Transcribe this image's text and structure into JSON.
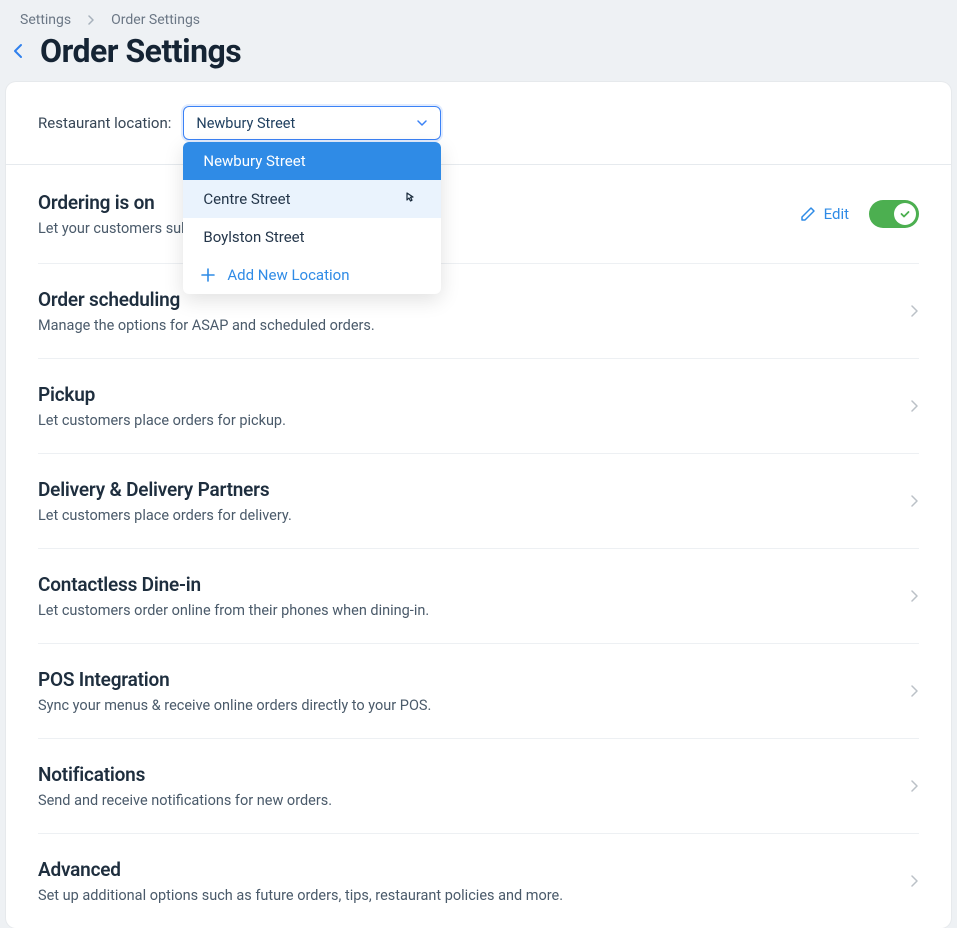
{
  "breadcrumb": {
    "root": "Settings",
    "current": "Order Settings"
  },
  "page": {
    "title": "Order Settings"
  },
  "location": {
    "label": "Restaurant location:",
    "selected": "Newbury Street",
    "options": {
      "opt0": "Newbury Street",
      "opt1": "Centre Street",
      "opt2": "Boylston Street"
    },
    "add_label": "Add New Location"
  },
  "edit": {
    "label": "Edit"
  },
  "sections": {
    "ordering": {
      "title": "Ordering is on",
      "desc": "Let your customers submit orders."
    },
    "scheduling": {
      "title": "Order scheduling",
      "desc": "Manage the options for ASAP and scheduled orders."
    },
    "pickup": {
      "title": "Pickup",
      "desc": "Let customers place orders for pickup."
    },
    "delivery": {
      "title": "Delivery & Delivery Partners",
      "desc": "Let customers place orders for delivery."
    },
    "dinein": {
      "title": "Contactless Dine-in",
      "desc": "Let customers order online from their phones when dining-in."
    },
    "pos": {
      "title": "POS Integration",
      "desc": "Sync your menus & receive online orders directly to your POS."
    },
    "notifications": {
      "title": "Notifications",
      "desc": "Send and receive notifications for new orders."
    },
    "advanced": {
      "title": "Advanced",
      "desc": "Set up additional options such as future orders, tips, restaurant policies and more."
    }
  }
}
